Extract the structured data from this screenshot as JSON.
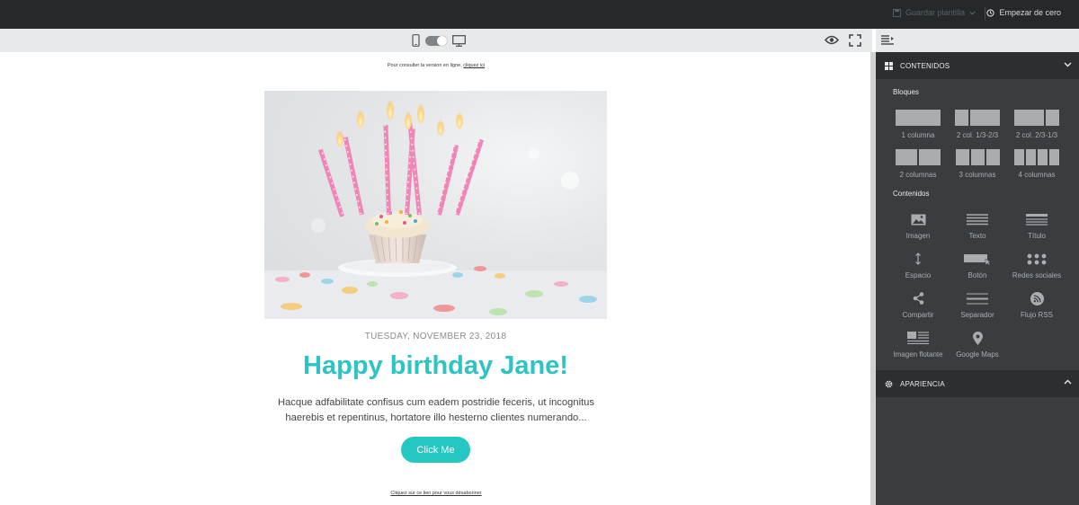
{
  "topbar": {
    "save_label": "Guardar plantilla",
    "reset_label": "Empezar de cero"
  },
  "email": {
    "view_online_prefix": "Pour consulter la version en ligne,",
    "view_online_link": "cliquez ici",
    "date": "TUESDAY, NOVEMBER 23, 2018",
    "title": "Happy birthday Jane!",
    "body": "Hacque adfabilitate confisus cum eadem postridie feceris, ut incognitus haerebis et repentinus, hortatore illo hesterno clientes numerando...",
    "cta_label": "Click Me",
    "unsubscribe": "Cliquez sur ce lien pour vous désabonner"
  },
  "panel": {
    "contents_header": "CONTENIDOS",
    "blocks_title": "Bloques",
    "blocks": [
      {
        "label": "1 columna"
      },
      {
        "label": "2 col. 1/3-2/3"
      },
      {
        "label": "2 col. 2/3-1/3"
      },
      {
        "label": "2 columnas"
      },
      {
        "label": "3 columnas"
      },
      {
        "label": "4 columnas"
      }
    ],
    "contents_title": "Contenidos",
    "contents": [
      {
        "label": "Imagen",
        "icon": "image-icon"
      },
      {
        "label": "Texto",
        "icon": "text-icon"
      },
      {
        "label": "Título",
        "icon": "title-icon"
      },
      {
        "label": "Espacio",
        "icon": "spacer-icon"
      },
      {
        "label": "Botón",
        "icon": "button-icon"
      },
      {
        "label": "Redes sociales",
        "icon": "social-icon"
      },
      {
        "label": "Compartir",
        "icon": "share-icon"
      },
      {
        "label": "Separador",
        "icon": "divider-icon"
      },
      {
        "label": "Flujo RSS",
        "icon": "rss-icon"
      },
      {
        "label": "Imagen flotante",
        "icon": "float-image-icon"
      },
      {
        "label": "Google Maps",
        "icon": "map-pin-icon"
      }
    ],
    "appearance_header": "APARIENCIA"
  },
  "colors": {
    "accent": "#2ec4c4",
    "button": "#24c7c2",
    "topbar": "#26292b",
    "panel": "#393d40"
  }
}
